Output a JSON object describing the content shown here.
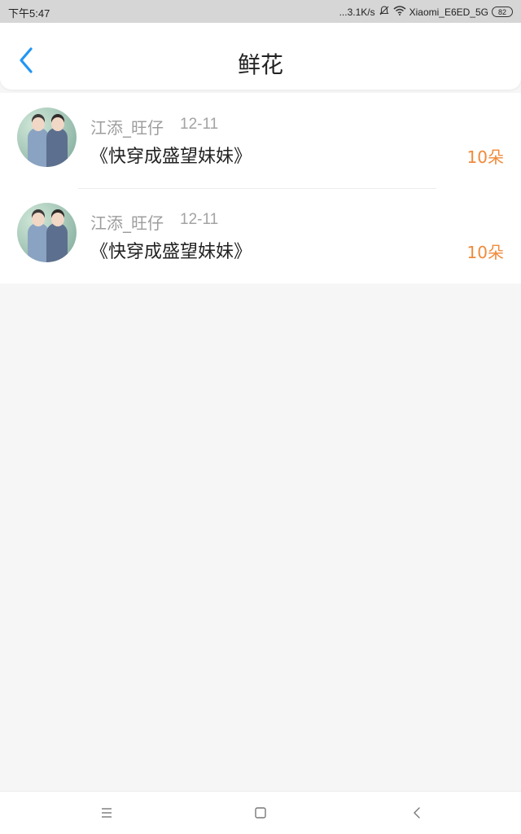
{
  "status_bar": {
    "time": "下午5:47",
    "network_speed": "...3.1K/s",
    "wifi_name": "Xiaomi_E6ED_5G",
    "battery": "82"
  },
  "header": {
    "title": "鲜花",
    "back_icon": "chevron-left-icon",
    "accent_color": "#2196f3"
  },
  "list": {
    "items": [
      {
        "username": "江添_旺仔",
        "date": "12-11",
        "book_title": "《快穿成盛望妹妹》",
        "flower_count": "10朵"
      },
      {
        "username": "江添_旺仔",
        "date": "12-11",
        "book_title": "《快穿成盛望妹妹》",
        "flower_count": "10朵"
      }
    ],
    "count_color": "#f08a3a"
  },
  "nav_bar": {
    "menu_icon": "menu-icon",
    "home_icon": "home-icon",
    "back_icon": "back-icon"
  }
}
